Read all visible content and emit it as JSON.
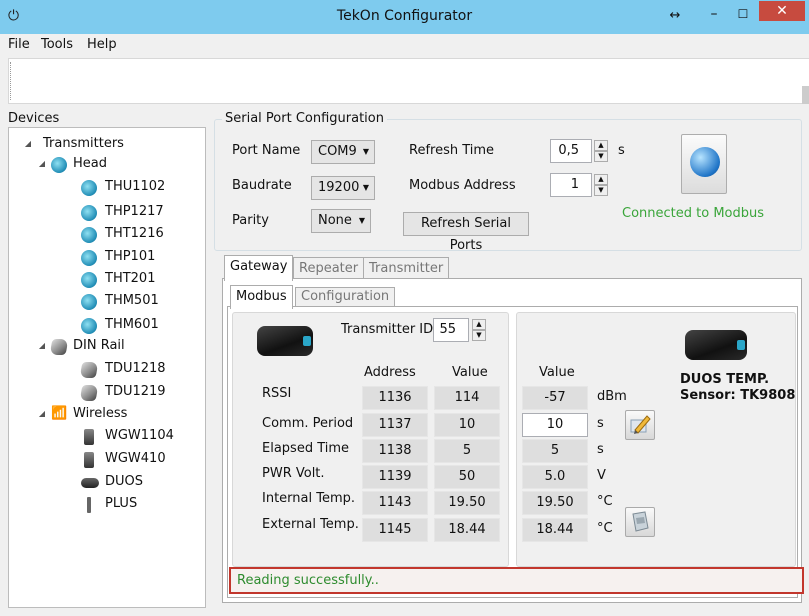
{
  "window": {
    "title": "TekOn Configurator",
    "icon": "power-icon"
  },
  "menu": {
    "items": [
      "File",
      "Tools",
      "Help"
    ]
  },
  "devices": {
    "label": "Devices",
    "root": "Transmitters",
    "head": {
      "label": "Head",
      "items": [
        "THU1102",
        "THP1217",
        "THT1216",
        "THP101",
        "THT201",
        "THM501",
        "THM601"
      ]
    },
    "din": {
      "label": "DIN Rail",
      "items": [
        "TDU1218",
        "TDU1219"
      ]
    },
    "wireless": {
      "label": "Wireless",
      "items": [
        "WGW1104",
        "WGW410",
        "DUOS",
        "PLUS"
      ]
    }
  },
  "serial": {
    "group_title": "Serial Port Configuration",
    "port_label": "Port Name",
    "port_value": "COM9",
    "baud_label": "Baudrate",
    "baud_value": "19200",
    "parity_label": "Parity",
    "parity_value": "None",
    "refresh_label": "Refresh Time",
    "refresh_value": "0,5",
    "refresh_unit": "s",
    "modbus_label": "Modbus Address",
    "modbus_value": "1",
    "refresh_ports_button": "Refresh Serial Ports",
    "status": "Connected to Modbus",
    "status_color": "#3aa53a"
  },
  "tabs": [
    "Gateway",
    "Repeater",
    "Transmitter"
  ],
  "subtabs": [
    "Modbus",
    "Configuration"
  ],
  "gateway": {
    "transmitter_id_label": "Transmitter ID",
    "transmitter_id": "55",
    "col_address": "Address",
    "col_value": "Value",
    "col_value_right": "Value",
    "device_name": "DUOS TEMP.",
    "sensor": "Sensor: TK9808",
    "rows": [
      {
        "label": "RSSI",
        "address": "1136",
        "value": "114",
        "right_value": "-57",
        "unit": "dBm"
      },
      {
        "label": "Comm. Period",
        "address": "1137",
        "value": "10",
        "right_value": "10",
        "unit": "s"
      },
      {
        "label": "Elapsed Time",
        "address": "1138",
        "value": "5",
        "right_value": "5",
        "unit": "s"
      },
      {
        "label": "PWR Volt.",
        "address": "1139",
        "value": "50",
        "right_value": "5.0",
        "unit": "V"
      },
      {
        "label": "Internal Temp.",
        "address": "1143",
        "value": "19.50",
        "right_value": "19.50",
        "unit": "°C"
      },
      {
        "label": "External Temp.",
        "address": "1145",
        "value": "18.44",
        "right_value": "18.44",
        "unit": "°C"
      }
    ]
  },
  "status_bar": {
    "text": "Reading successfully.."
  }
}
